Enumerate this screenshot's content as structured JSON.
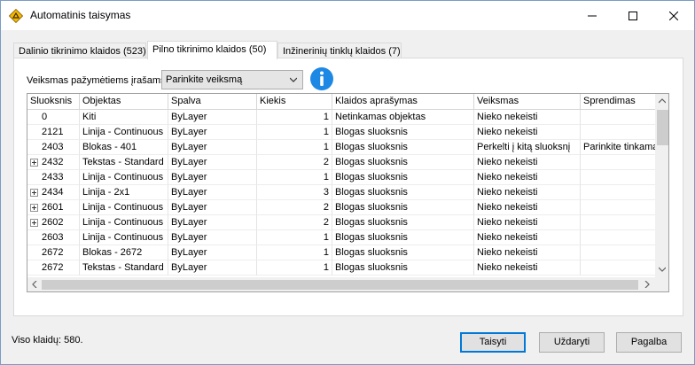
{
  "window": {
    "title": "Automatinis taisymas",
    "controls": {
      "minimize": "—",
      "maximize": "☐",
      "close": "✕"
    }
  },
  "tabs": [
    {
      "label": "Dalinio tikrinimo klaidos (523)",
      "active": false
    },
    {
      "label": "Pilno tikrinimo klaidos (50)",
      "active": true
    },
    {
      "label": "Inžinerinių tinklų klaidos (7)",
      "active": false
    }
  ],
  "action": {
    "label": "Veiksmas pažymėtiems įrašams:",
    "selected": "Parinkite veiksmą"
  },
  "table": {
    "columns": [
      "Sluoksnis",
      "Objektas",
      "Spalva",
      "Kiekis",
      "Klaidos aprašymas",
      "Veiksmas",
      "Sprendimas"
    ],
    "rows": [
      {
        "expand": false,
        "code": "0",
        "object": "Kiti",
        "color": "ByLayer",
        "count": "1",
        "desc": "Netinkamas objektas",
        "action": "Nieko nekeisti",
        "solution": ""
      },
      {
        "expand": false,
        "code": "2121",
        "object": "Linija - Continuous",
        "color": "ByLayer",
        "count": "1",
        "desc": "Blogas sluoksnis",
        "action": "Nieko nekeisti",
        "solution": ""
      },
      {
        "expand": false,
        "code": "2403",
        "object": "Blokas - 401",
        "color": "ByLayer",
        "count": "1",
        "desc": "Blogas sluoksnis",
        "action": "Perkelti į kitą sluoksnį",
        "solution": "Parinkite tinkamą"
      },
      {
        "expand": true,
        "code": "2432",
        "object": "Tekstas - Standard",
        "color": "ByLayer",
        "count": "2",
        "desc": "Blogas sluoksnis",
        "action": "Nieko nekeisti",
        "solution": ""
      },
      {
        "expand": false,
        "code": "2433",
        "object": "Linija - Continuous",
        "color": "ByLayer",
        "count": "1",
        "desc": "Blogas sluoksnis",
        "action": "Nieko nekeisti",
        "solution": ""
      },
      {
        "expand": true,
        "code": "2434",
        "object": "Linija - 2x1",
        "color": "ByLayer",
        "count": "3",
        "desc": "Blogas sluoksnis",
        "action": "Nieko nekeisti",
        "solution": ""
      },
      {
        "expand": true,
        "code": "2601",
        "object": "Linija - Continuous",
        "color": "ByLayer",
        "count": "2",
        "desc": "Blogas sluoksnis",
        "action": "Nieko nekeisti",
        "solution": ""
      },
      {
        "expand": true,
        "code": "2602",
        "object": "Linija - Continuous",
        "color": "ByLayer",
        "count": "2",
        "desc": "Blogas sluoksnis",
        "action": "Nieko nekeisti",
        "solution": ""
      },
      {
        "expand": false,
        "code": "2603",
        "object": "Linija - Continuous",
        "color": "ByLayer",
        "count": "1",
        "desc": "Blogas sluoksnis",
        "action": "Nieko nekeisti",
        "solution": ""
      },
      {
        "expand": false,
        "code": "2672",
        "object": "Blokas - 2672",
        "color": "ByLayer",
        "count": "1",
        "desc": "Blogas sluoksnis",
        "action": "Nieko nekeisti",
        "solution": ""
      },
      {
        "expand": false,
        "code": "2672",
        "object": "Tekstas - Standard",
        "color": "ByLayer",
        "count": "1",
        "desc": "Blogas sluoksnis",
        "action": "Nieko nekeisti",
        "solution": ""
      }
    ]
  },
  "footer": {
    "total": "Viso klaidų: 580.",
    "buttons": {
      "fix": "Taisyti",
      "close": "Uždaryti",
      "help": "Pagalba"
    }
  },
  "colors": {
    "accent": "#0078d7",
    "info": "#1e88e5",
    "app_icon": "#f5b800"
  }
}
